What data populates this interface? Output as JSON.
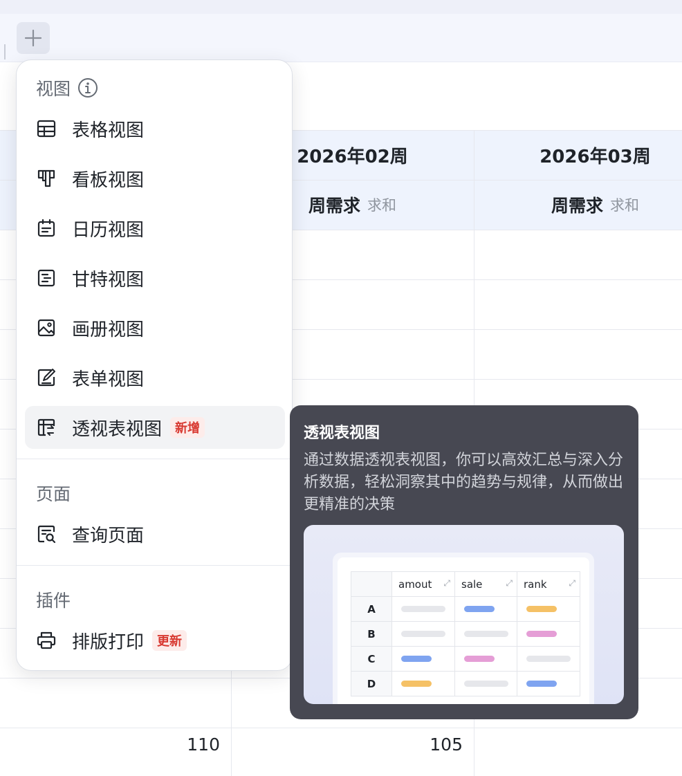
{
  "table": {
    "columns": [
      {
        "title": "2026年02周",
        "field": "周需求",
        "agg": "求和"
      },
      {
        "title": "2026年03周",
        "field": "周需求",
        "agg": "求和"
      }
    ],
    "bottom_values": [
      "110",
      "105"
    ]
  },
  "menu": {
    "groups": [
      {
        "title": "视图",
        "items": [
          {
            "label": "表格视图",
            "icon": "table-icon"
          },
          {
            "label": "看板视图",
            "icon": "kanban-icon"
          },
          {
            "label": "日历视图",
            "icon": "calendar-icon"
          },
          {
            "label": "甘特视图",
            "icon": "gantt-icon"
          },
          {
            "label": "画册视图",
            "icon": "gallery-icon"
          },
          {
            "label": "表单视图",
            "icon": "form-icon"
          },
          {
            "label": "透视表视图",
            "icon": "pivot-table-icon",
            "badge": "新增"
          }
        ]
      },
      {
        "title": "页面",
        "items": [
          {
            "label": "查询页面",
            "icon": "query-page-icon"
          }
        ]
      },
      {
        "title": "插件",
        "items": [
          {
            "label": "排版打印",
            "icon": "printer-icon",
            "badge": "更新"
          }
        ]
      }
    ]
  },
  "tooltip": {
    "title": "透视表视图",
    "description": "通过数据透视表视图，你可以高效汇总与深入分析数据，轻松洞察其中的趋势与规律，从而做出更精准的决策",
    "preview": {
      "headers": [
        "amout",
        "sale",
        "rank"
      ],
      "rows": [
        "A",
        "B",
        "C",
        "D"
      ]
    }
  },
  "colors": {
    "badge_text": "#d83931",
    "badge_bg": "#fdecea",
    "tooltip_bg": "#474852",
    "bar_gray": "#e6e7eb",
    "bar_blue": "#7fa4f0",
    "bar_yellow": "#f5c166",
    "bar_pink": "#e59ed6"
  }
}
